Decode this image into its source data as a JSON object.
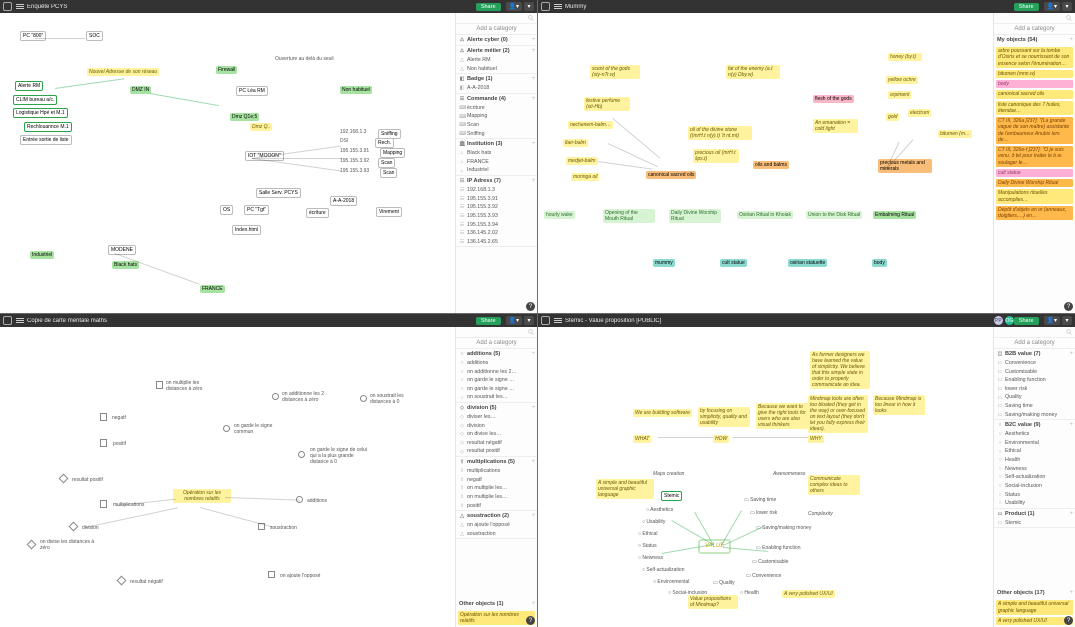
{
  "pane1": {
    "title": "Enquête PCYS",
    "share": "Share",
    "addcat": "Add a category",
    "groups": [
      {
        "icon": "⚠",
        "label": "Alerte cyber (0)",
        "items": []
      },
      {
        "icon": "⚠",
        "label": "Alerte métier (2)",
        "items": [
          {
            "icon": "△",
            "label": "Alerte RM"
          },
          {
            "icon": "△",
            "label": "Non habituel"
          }
        ]
      },
      {
        "icon": "◧",
        "label": "Badge (1)",
        "items": [
          {
            "icon": "◧",
            "label": "A-A-2018"
          }
        ]
      },
      {
        "icon": "☰",
        "label": "Commande (4)",
        "items": [
          {
            "icon": "⌨",
            "label": "écriture"
          },
          {
            "icon": "⌨",
            "label": "Mapping"
          },
          {
            "icon": "⌨",
            "label": "Scan"
          },
          {
            "icon": "⌨",
            "label": "Sniffing"
          }
        ]
      },
      {
        "icon": "🏛",
        "label": "Institution (3)",
        "items": [
          {
            "icon": "⌂",
            "label": "Black hats"
          },
          {
            "icon": "⌂",
            "label": "FRANCE"
          },
          {
            "icon": "⌂",
            "label": "Industriel"
          }
        ]
      },
      {
        "icon": "☷",
        "label": "IP Adress (7)",
        "items": [
          {
            "icon": "☷",
            "label": "192.168.1.3"
          },
          {
            "icon": "☷",
            "label": "195.155.3.91"
          },
          {
            "icon": "☷",
            "label": "195.155.3.92"
          },
          {
            "icon": "☷",
            "label": "195.155.3.93"
          },
          {
            "icon": "☷",
            "label": "195.155.3.94"
          },
          {
            "icon": "☷",
            "label": "136.145.2.02"
          },
          {
            "icon": "☷",
            "label": "136.145.2.65"
          }
        ]
      }
    ],
    "canvas": {
      "node_800": "PC \"800\"",
      "node_soc": "SOC",
      "note_top": "Ouverture au delà du seuil",
      "node_fw": "Firewall",
      "note_dhcp": "Nouvel Adresse de son réseau",
      "node_zdmz": "DMZ IN",
      "node_pc_rm": "PC Léa RM",
      "node_alerte_rm": "Alerte RM",
      "node_clim": "CLIM bureau a/c.",
      "node_logistics": "Logistique Hpé et M.1",
      "node_rech": "Rechlouannce M.1",
      "node_aa2018": "A-A-2018",
      "node_iot": "IOT \"MOOON\"",
      "node_fr": "FRANCE",
      "node_industriel": "Industriel",
      "node_bh": "Black hats",
      "node_env": "Entrée sortie de liste",
      "node_modene": "MODENE",
      "node_mapping": "Mapping",
      "node_scan": "Scan",
      "node_sniff": "Sniffing",
      "node_dmz2": "Dmz Q1e;5",
      "node_nonhab": "Non habituel",
      "node_salle": "Salle Serv. PCYS",
      "node_os": "OS",
      "node_index": "Index.html",
      "node_pctgt": "PC \"Tgt\"",
      "node_writing": "écriture",
      "node_virement": "Virement",
      "ip_labels": [
        "192.168.1.3",
        "195.155.3.91",
        "195.155.3.92",
        "195.155.3.93",
        "195.155.3.94",
        "136.145.2.02",
        "136.145.2.65"
      ]
    }
  },
  "pane2": {
    "title": "Mummy",
    "share": "Share",
    "addcat": "Add a category",
    "my_objects": "My objects (54)",
    "side_notes": [
      {
        "cls": "",
        "text": "arbre poussant sur la tombe d'Osiris et se nourrissant de son essence selon l'énumération…"
      },
      {
        "cls": "",
        "text": "bitumen (mnn.w)"
      },
      {
        "cls": "pk",
        "text": "body"
      },
      {
        "cls": "",
        "text": "canonical sacred oils"
      },
      {
        "cls": "",
        "text": "liste canonique des 7 huiles, étendue…"
      },
      {
        "cls": "or",
        "text": "CT III, 326a [237]: \"(La grande vague de son maître) assistante de l'embaumeur Anubis lors de…"
      },
      {
        "cls": "or",
        "text": "CT III, 326e-f [237]: \"O je suis venu, ô tel pour traiter le b.w. soulager le…"
      },
      {
        "cls": "pk",
        "text": "cult statue"
      },
      {
        "cls": "or",
        "text": "Daily Divine Worship Ritual"
      },
      {
        "cls": "",
        "text": "Manipulations rituelles accomplies…"
      },
      {
        "cls": "or",
        "text": "Dépôt d'objets en or (anneaux, doigtiers,…) en…"
      }
    ],
    "canvas": {
      "honey": "honey (by.t)",
      "yellow_ochre": "yellow ochre",
      "orpiment": "orpiment",
      "electrum": "electrum",
      "gold": "gold",
      "bitumen": "bitumen (m…",
      "metals": "precious metals and minerals",
      "scent": "scent of the gods (sty-nTr.w)",
      "fat_enemy": "fat of the enemy (a.t n(y) Dby.w)",
      "perfume": "festive perfume (sti-Hb)",
      "nechenem": "nechenem-balm…",
      "iber": "iber-balm",
      "medjet": "medjet-balm",
      "moringa": "moringa oil",
      "oil_stone": "oil of the divine stone ((mrH.t n(y).t) 'it nt.mt)",
      "precious_oil": "precious oil (mrH.t šps.t)",
      "oils_balms": "oils and balms",
      "emanation": "An emanation = cold light",
      "flesh": "flesh of the gods",
      "canonical": "canonical sacred oils",
      "hourly": "hourly wake",
      "opening": "Opening of the Mouth Ritual",
      "daily": "Daily Divine Worship Ritual",
      "osirian": "Osirian Ritual in Khoiak",
      "union": "Union to the Disk Ritual",
      "embalming": "Embalming Ritual",
      "mummy": "mummy",
      "cult": "cult statue",
      "osirian_stat": "osirian statuette",
      "body": "body"
    }
  },
  "pane3": {
    "title": "Copie de carte mentale maths",
    "share": "Share",
    "addcat": "Add a category",
    "groups": [
      {
        "icon": "○",
        "label": "additions (5)",
        "items": [
          {
            "icon": "○",
            "label": "additions"
          },
          {
            "icon": "○",
            "label": "on additionne les 2…"
          },
          {
            "icon": "○",
            "label": "on garde le signe …"
          },
          {
            "icon": "○",
            "label": "on garde le signe …"
          },
          {
            "icon": "○",
            "label": "on soustrait les…"
          }
        ]
      },
      {
        "icon": "◇",
        "label": "division (5)",
        "items": [
          {
            "icon": "◇",
            "label": "diviser les…"
          },
          {
            "icon": "◇",
            "label": "division"
          },
          {
            "icon": "◇",
            "label": "on divise les…"
          },
          {
            "icon": "◇",
            "label": "resultat négatif"
          },
          {
            "icon": "◇",
            "label": "resultat positif"
          }
        ]
      },
      {
        "icon": "⇧",
        "label": "multiplications (5)",
        "items": [
          {
            "icon": "⇧",
            "label": "multiplications"
          },
          {
            "icon": "⇧",
            "label": "negatf"
          },
          {
            "icon": "⇧",
            "label": "on multiplie les…"
          },
          {
            "icon": "⇧",
            "label": "on multiplie les…"
          },
          {
            "icon": "⇧",
            "label": "positif"
          }
        ]
      },
      {
        "icon": "△",
        "label": "soustraction (2)",
        "items": [
          {
            "icon": "△",
            "label": "on ajoute l'opposé"
          },
          {
            "icon": "△",
            "label": "soustraction"
          }
        ]
      }
    ],
    "other": "Other objects (1)",
    "other_note": "Opération sur les nombres relatifs",
    "canvas": {
      "note_center": "Opération sur les nombres relatifs",
      "mul_zero": "on multiplie les distances à zéro",
      "add_two": "on additionne les 2 distances à zéro",
      "sub_dist": "on soustrait les distances à 0",
      "negatf": "negatf",
      "positif": "positif",
      "garde_commun": "on garde le signe commun",
      "garde_plus": "on garde le signe de celui qui a la plus grande distance à 0",
      "res_pos": "resultat positif",
      "mul": "multiplications",
      "additions": "additions",
      "division": "division",
      "soustraction": "soustraction",
      "div_zero": "on divise les distances à zéro",
      "res_neg": "resultat négatif",
      "ajoute_opp": "on ajoute l'opposé"
    }
  },
  "pane4": {
    "title": "Stemic - Value proposition [PUBLIC]",
    "share": "Share",
    "addcat": "Add a category",
    "avatars": [
      "PP",
      "OG"
    ],
    "groups": [
      {
        "icon": "◫",
        "label": "B2B value (7)",
        "items": [
          {
            "icon": "▭",
            "label": "Convenience"
          },
          {
            "icon": "▭",
            "label": "Customisable"
          },
          {
            "icon": "▭",
            "label": "Enabling function"
          },
          {
            "icon": "▭",
            "label": "lower risk"
          },
          {
            "icon": "▭",
            "label": "Quality"
          },
          {
            "icon": "▭",
            "label": "Saving time"
          },
          {
            "icon": "▭",
            "label": "Saving/making money"
          }
        ]
      },
      {
        "icon": "○",
        "label": "B2C value (9)",
        "items": [
          {
            "icon": "○",
            "label": "Aesthetics"
          },
          {
            "icon": "○",
            "label": "Environmental"
          },
          {
            "icon": "○",
            "label": "Ethical"
          },
          {
            "icon": "○",
            "label": "Health"
          },
          {
            "icon": "○",
            "label": "Newness"
          },
          {
            "icon": "○",
            "label": "Self-actualization"
          },
          {
            "icon": "○",
            "label": "Social-inclusion"
          },
          {
            "icon": "○",
            "label": "Status"
          },
          {
            "icon": "○",
            "label": "Usability"
          }
        ]
      },
      {
        "icon": "▭",
        "label": "Product (1)",
        "items": [
          {
            "icon": "▭",
            "label": "Stemic"
          }
        ]
      }
    ],
    "other": "Other objects (17)",
    "other_notes": [
      "A simple and beautiful universal graphic language",
      "A very polished UX/UI"
    ],
    "canvas": {
      "note_designers": "As former designers we have learned the value of simplicity. We believe that this simple state in order to properly communicate an idea.",
      "note_mindmap": "Mindmap tools are often too bloated (they get in the way) or over‑focused on text layout (they don't let you fully express their ideas).",
      "note_because": "Because Mindmap is too linear in how it looks",
      "note_because2": "Because we want to give the right tools for users who are also visual thinkers",
      "note_simplicity": "by focusing on simplicity, quality and usability",
      "note_build": "We are building software",
      "note_lang": "A simple and beautiful universal graphic language",
      "note_ux": "A very polished UX/UI",
      "note_value_props": "Value propositions of Mindmap?",
      "note_comm": "Communicate complex ideas to others",
      "tag_what": "WHAT",
      "tag_how": "HOW",
      "tag_why": "WHY",
      "maps": "Maps creation",
      "awesome": "Awesomeness",
      "complex": "Complexity",
      "stemic": "Stemic",
      "value": "VALUE",
      "aesth": "Aesthetics",
      "usab": "Usability",
      "saving_time": "Saving time",
      "ethical": "Ethical",
      "status": "Status",
      "newness": "Newness",
      "selfact": "Self-actualization",
      "env": "Environmental",
      "social": "Social-inclusion",
      "health": "Health",
      "saving_money": "Saving/making money",
      "lower_risk": "lower risk",
      "enabling": "Enabling function",
      "custom": "Customisable",
      "conv": "Convenience",
      "quality": "Quality"
    }
  }
}
